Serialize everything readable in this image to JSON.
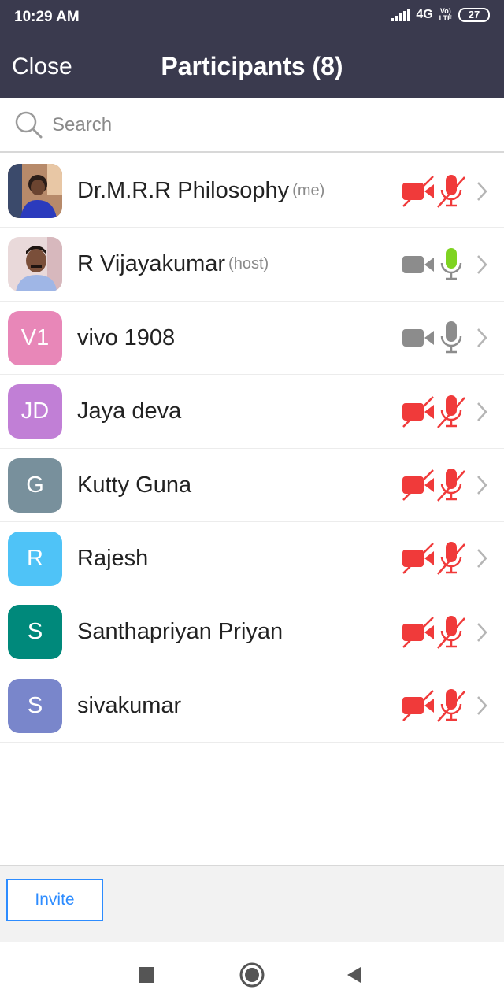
{
  "status_bar": {
    "time": "10:29 AM",
    "network": "4G",
    "volte_line1": "Vo)",
    "volte_line2": "LTE",
    "battery": "27"
  },
  "header": {
    "close_label": "Close",
    "title": "Participants (8)"
  },
  "search": {
    "placeholder": "Search"
  },
  "participants": [
    {
      "name": "Dr.M.R.R Philosophy",
      "tag": "(me)",
      "avatar_initials": "",
      "avatar_type": "photo",
      "video": "off",
      "audio": "muted"
    },
    {
      "name": "R Vijayakumar",
      "tag": "(host)",
      "avatar_initials": "",
      "avatar_type": "photo",
      "video": "on",
      "audio": "speaking"
    },
    {
      "name": "vivo 1908",
      "tag": "",
      "avatar_initials": "V1",
      "avatar_color": "#e887b8",
      "video": "on",
      "audio": "unmuted"
    },
    {
      "name": "Jaya deva",
      "tag": "",
      "avatar_initials": "JD",
      "avatar_color": "#c17fd6",
      "video": "off",
      "audio": "muted"
    },
    {
      "name": "Kutty Guna",
      "tag": "",
      "avatar_initials": "G",
      "avatar_color": "#78909c",
      "video": "off",
      "audio": "muted"
    },
    {
      "name": "Rajesh",
      "tag": "",
      "avatar_initials": "R",
      "avatar_color": "#4fc3f7",
      "video": "off",
      "audio": "muted"
    },
    {
      "name": "Santhapriyan Priyan",
      "tag": "",
      "avatar_initials": "S",
      "avatar_color": "#00897b",
      "video": "off",
      "audio": "muted"
    },
    {
      "name": "sivakumar",
      "tag": "",
      "avatar_initials": "S",
      "avatar_color": "#7986cb",
      "video": "off",
      "audio": "muted"
    }
  ],
  "footer": {
    "invite_label": "Invite"
  },
  "colors": {
    "header_bg": "#3a3a4e",
    "muted_red": "#f03a3a",
    "speaking_green": "#7ed321",
    "neutral_grey": "#8c8c8c",
    "accent_blue": "#2d8cff"
  },
  "icons": {
    "nav": [
      "square-recents-icon",
      "circle-home-icon",
      "triangle-back-icon"
    ]
  }
}
